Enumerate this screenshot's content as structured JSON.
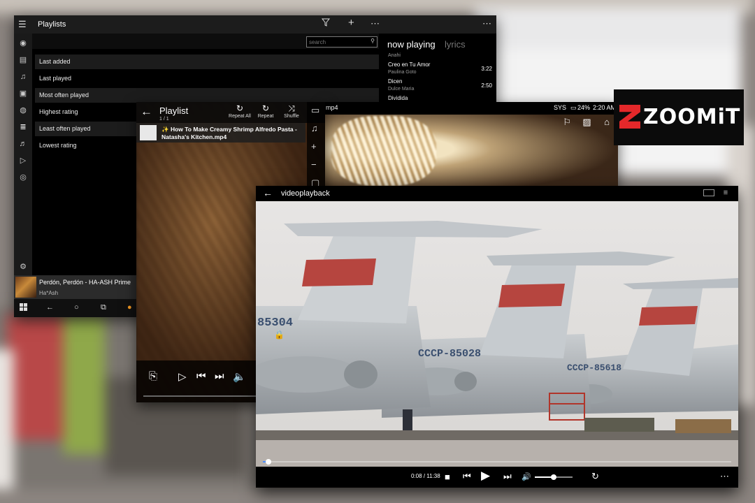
{
  "music_app": {
    "title": "Playlists",
    "search_placeholder": "search",
    "playlists": [
      {
        "label": "Last added"
      },
      {
        "label": "Last played"
      },
      {
        "label": "Most often played"
      },
      {
        "label": "Highest rating"
      },
      {
        "label": "Least often played"
      },
      {
        "label": "Lowest rating"
      }
    ],
    "now_playing_tab": "now playing",
    "lyrics_tab": "lyrics",
    "queue": [
      {
        "title": "",
        "artist": "Anahi",
        "duration": ""
      },
      {
        "title": "Creo en Tu Amor",
        "artist": "Paulina Goto",
        "duration": "3:22"
      },
      {
        "title": "Dicen",
        "artist": "Dulce Maria",
        "duration": "2:50"
      },
      {
        "title": "Dividida",
        "artist": "",
        "duration": ""
      }
    ],
    "mini_player": {
      "title": "Perdón, Perdón - HA-ASH Prime",
      "artist": "Ha*Ash"
    }
  },
  "video_playlist": {
    "title": "Playlist",
    "count": "1 / 1",
    "actions": [
      {
        "label": "Repeat All"
      },
      {
        "label": "Repeat"
      },
      {
        "label": "Shuffle"
      }
    ],
    "item_title": "✨ How To Make Creamy Shrimp Alfredo Pasta - Natasha's Kitchen.mp4"
  },
  "food_window": {
    "tab_fragment": "mp4",
    "status_sys": "SYS",
    "battery": "24%",
    "clock": "2:20 AM"
  },
  "zoomit": {
    "brand": "ZOOMiT"
  },
  "videoplayback": {
    "title": "videoplayback",
    "time_current": "0:08",
    "time_separator": "/",
    "time_total": "11:38",
    "seek_fraction": 0.012,
    "volume_fraction": 0.5,
    "aircraft_codes": [
      "85304",
      "CCCP-85028",
      "CCCP-85618"
    ]
  },
  "colors": {
    "accent_red": "#e4282a",
    "seek_blue": "#4a8cff"
  }
}
